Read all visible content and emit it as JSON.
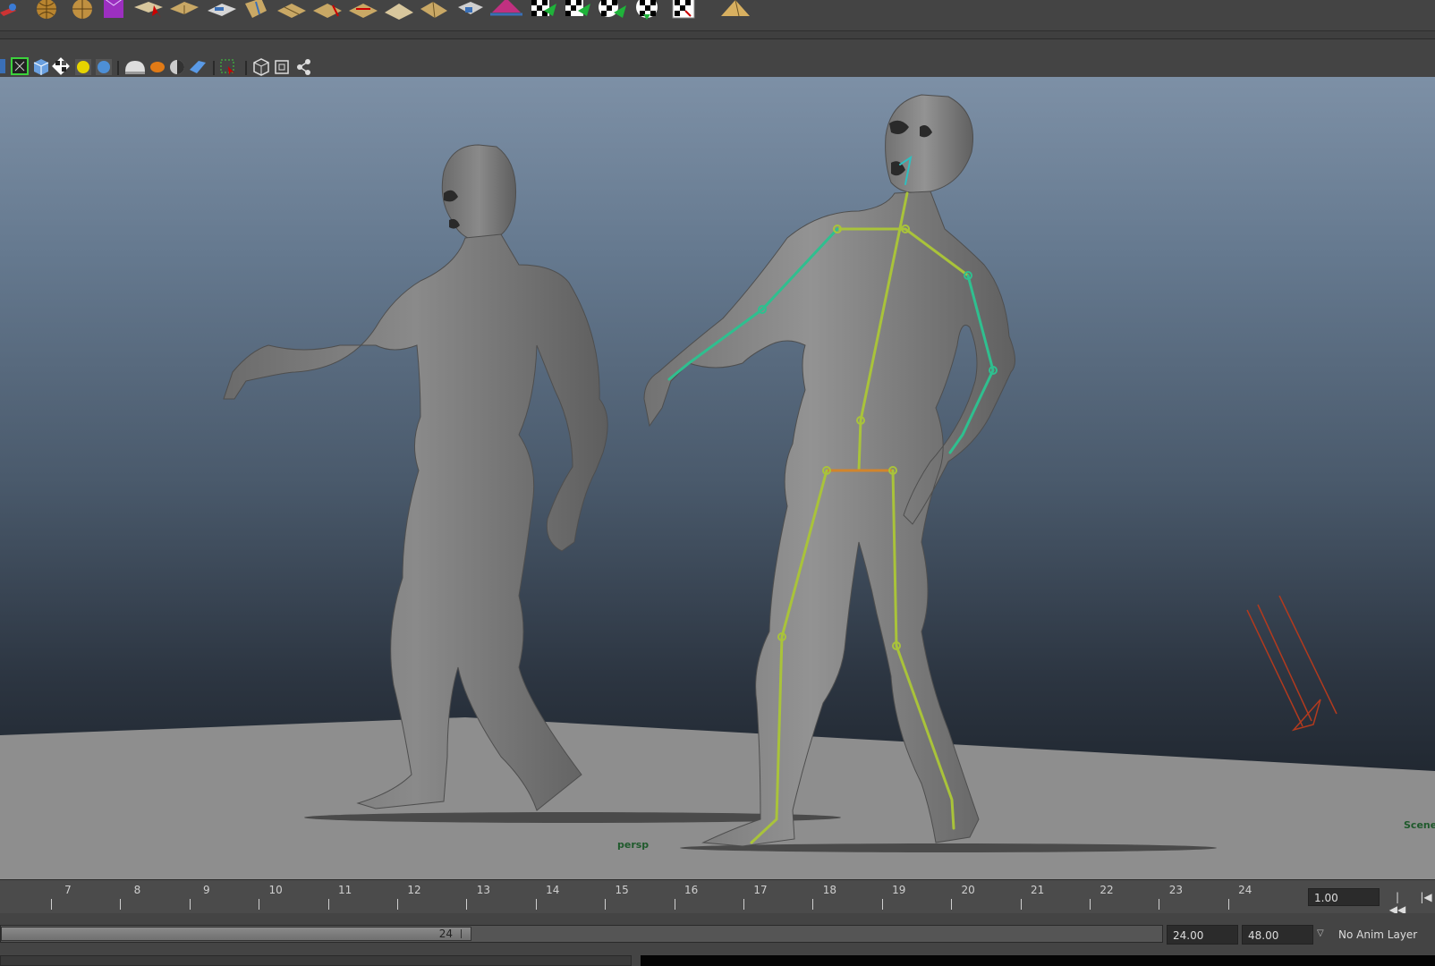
{
  "shelf": {
    "icons": [
      "rendering-icon",
      "sphere-grid-icon",
      "sphere-grid-icon-2",
      "cube-texture-icon",
      "uv-select-icon",
      "uv-unfold-icon",
      "uv-plane-icon",
      "uv-cylinder-icon",
      "uv-layout-icon",
      "uv-cut-icon",
      "uv-sew-icon",
      "uv-flatten-icon",
      "uv-pyramid-icon",
      "uv-move-icon",
      "uv-normalize-icon",
      "uv-relax-icon",
      "checker-arrow-icon",
      "checker-arrow-icon-2",
      "checker-smooth-icon",
      "checker-icon",
      "checker-select-icon",
      "uv-pyramid-icon-2"
    ]
  },
  "panel_toolbar": {
    "icons": [
      "isolate-icon",
      "wireframe-shaded-icon",
      "textured-icon",
      "checker-icon",
      "lights-icon",
      "shadows-icon",
      "xray-icon",
      "xray-joints-icon",
      "xray-components-icon",
      "backface-icon",
      "select-camera-icon",
      "cube-icon",
      "frame-icon",
      "share-icon"
    ]
  },
  "viewport": {
    "camera_label": "persp",
    "scene_label": "Scene",
    "colors": {
      "sky_top": "#7d90a6",
      "sky_bottom": "#151a20",
      "ground": "#8e8e8e",
      "skin": "#7c7c7c",
      "joint": "#a9c33a",
      "joint_arm": "#2fbf8f",
      "light": "#b23a1e"
    }
  },
  "timeslider": {
    "frames": [
      "7",
      "8",
      "9",
      "10",
      "11",
      "12",
      "13",
      "14",
      "15",
      "16",
      "17",
      "18",
      "19",
      "20",
      "21",
      "22",
      "23",
      "24"
    ],
    "current_frame": "1.00",
    "buttons": {
      "go_start": "|◀◀",
      "step_back": "|◀"
    }
  },
  "range_slider": {
    "handle_value": "24",
    "end_time": "24.00",
    "anim_end": "48.00",
    "anim_layer": "No Anim Layer"
  }
}
